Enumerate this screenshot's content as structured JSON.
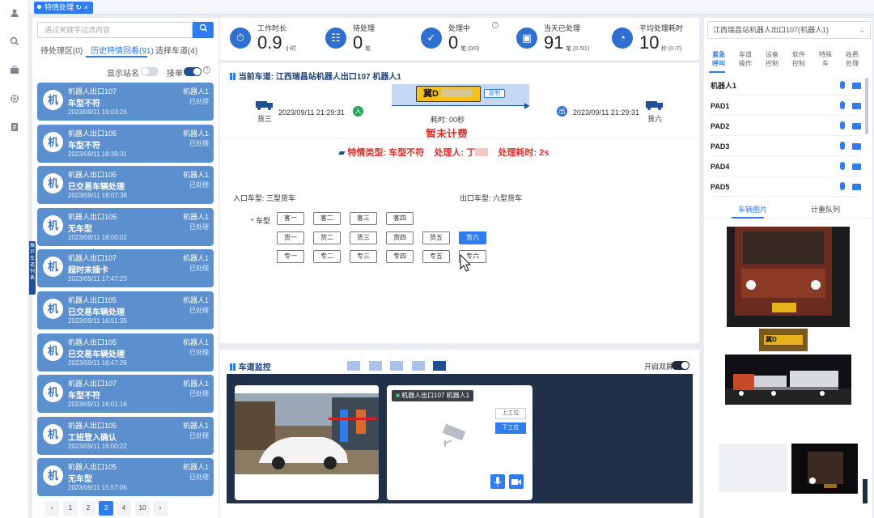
{
  "tab": {
    "label": "特情处理"
  },
  "left": {
    "search_placeholder": "通过关键字过滤内容",
    "tabs": [
      "待处理区(0)",
      "历史特情回看(91)",
      "选择车道(4)"
    ],
    "show_station_label": "显示站名",
    "accept_label": "接单",
    "cards": [
      {
        "avatar": "机",
        "lane": "机器人出口107",
        "type": "车型不符",
        "time": "2023/09/11 19:03:26",
        "robot": "机器人1",
        "status": "已处理"
      },
      {
        "avatar": "机",
        "lane": "机器人出口105",
        "type": "车型不符",
        "time": "2023/09/11 18:39:31",
        "robot": "机器人1",
        "status": "已处理"
      },
      {
        "avatar": "机",
        "lane": "机器人出口105",
        "type": "已交易车辆处理",
        "time": "2023/09/11 18:07:38",
        "robot": "机器人1",
        "status": "已处理"
      },
      {
        "avatar": "机",
        "lane": "机器人出口105",
        "type": "无车型",
        "time": "2023/09/11 18:00:02",
        "robot": "机器人1",
        "status": "已处理"
      },
      {
        "avatar": "机",
        "lane": "机器人出口107",
        "type": "超时未插卡",
        "time": "2023/09/11 17:47:23",
        "robot": "机器人1",
        "status": "已处理"
      },
      {
        "avatar": "机",
        "lane": "机器人出口105",
        "type": "已交易车辆处理",
        "time": "2023/09/11 16:51:35",
        "robot": "机器人1",
        "status": "已处理"
      },
      {
        "avatar": "机",
        "lane": "机器人出口105",
        "type": "已交易车辆处理",
        "time": "2023/09/11 16:47:26",
        "robot": "机器人1",
        "status": "已处理"
      },
      {
        "avatar": "机",
        "lane": "机器人出口107",
        "type": "车型不符",
        "time": "2023/09/11 16:01:16",
        "robot": "机器人1",
        "status": "已处理"
      },
      {
        "avatar": "机",
        "lane": "机器人出口105",
        "type": "工班登入确认",
        "time": "2023/09/11 16:00:22",
        "robot": "机器人1",
        "status": "已处理"
      },
      {
        "avatar": "机",
        "lane": "机器人出口105",
        "type": "无车型",
        "time": "2023/09/11 15:57:06",
        "robot": "机器人1",
        "status": "已处理"
      }
    ],
    "pager": [
      "‹",
      "1",
      "2",
      "3",
      "4",
      "10",
      "›"
    ],
    "side_handle": "展开车道列表"
  },
  "stats": [
    {
      "label": "工作时长",
      "value": "0.9",
      "unit": "小时"
    },
    {
      "label": "待处理",
      "value": "0",
      "unit": "笔"
    },
    {
      "label": "处理中",
      "value": "0",
      "unit": "笔 (0/0)"
    },
    {
      "label": "当天已处理",
      "value": "91",
      "unit": "笔 (0 /91)"
    },
    {
      "label": "平均处理耗时",
      "value": "10",
      "unit": "秒 (0 /7)"
    }
  ],
  "main": {
    "current_lane": "当前车道: 江西瑞昌站机器人出口107 机器人1",
    "plate": "冀D",
    "copy_label": "复制",
    "entry_time": "2023/09/11 21:29:31",
    "exit_time": "2023/09/11 21:29:31",
    "entry_vehicle": "货三",
    "exit_vehicle": "货六",
    "entry_badge": "入",
    "exit_badge": "出",
    "elapsed": "耗时: 00秒",
    "fee_status": "暂未计费",
    "special_type_label": "特情类型: ",
    "special_type": "车型不符",
    "handler_label": "处理人: ",
    "handler": "丁",
    "duration_label": "处理耗时: ",
    "duration": "2s",
    "entry_type_label": "入口车型: 三型货车",
    "exit_type_label": "出口车型: 六型货车",
    "vehicle_type_label": "* 车型",
    "row1": [
      "客一",
      "客二",
      "客三",
      "客四"
    ],
    "row2": [
      "货一",
      "货二",
      "货三",
      "货四",
      "货五",
      "货六"
    ],
    "row3": [
      "专一",
      "专二",
      "专三",
      "专四",
      "专五",
      "专六"
    ],
    "selected": "货六"
  },
  "monitor": {
    "title": "车道监控",
    "dual_screen": "开启双屏",
    "cam_label": "机器人出口107 机器人1",
    "up_btn": "上工位",
    "down_btn": "下工位"
  },
  "right": {
    "lane_select": "江西瑞昌站机器人出口107(机器人1)",
    "tabs": [
      [
        "紧急",
        "呼叫"
      ],
      [
        "车道",
        "操作"
      ],
      [
        "设备",
        "控制"
      ],
      [
        "软件",
        "控制"
      ],
      [
        "特殊",
        "车"
      ],
      [
        "收费",
        "处理"
      ]
    ],
    "devices": [
      "机器人1",
      "PAD1",
      "PAD2",
      "PAD3",
      "PAD4",
      "PAD5"
    ],
    "img_tabs": [
      "车辆图片",
      "计重队列"
    ],
    "small_plate": "冀D"
  },
  "colors": {
    "accent": "#2f7cf0",
    "card": "#5b8fce",
    "alert": "#d9302c",
    "dark": "#1f3048"
  }
}
